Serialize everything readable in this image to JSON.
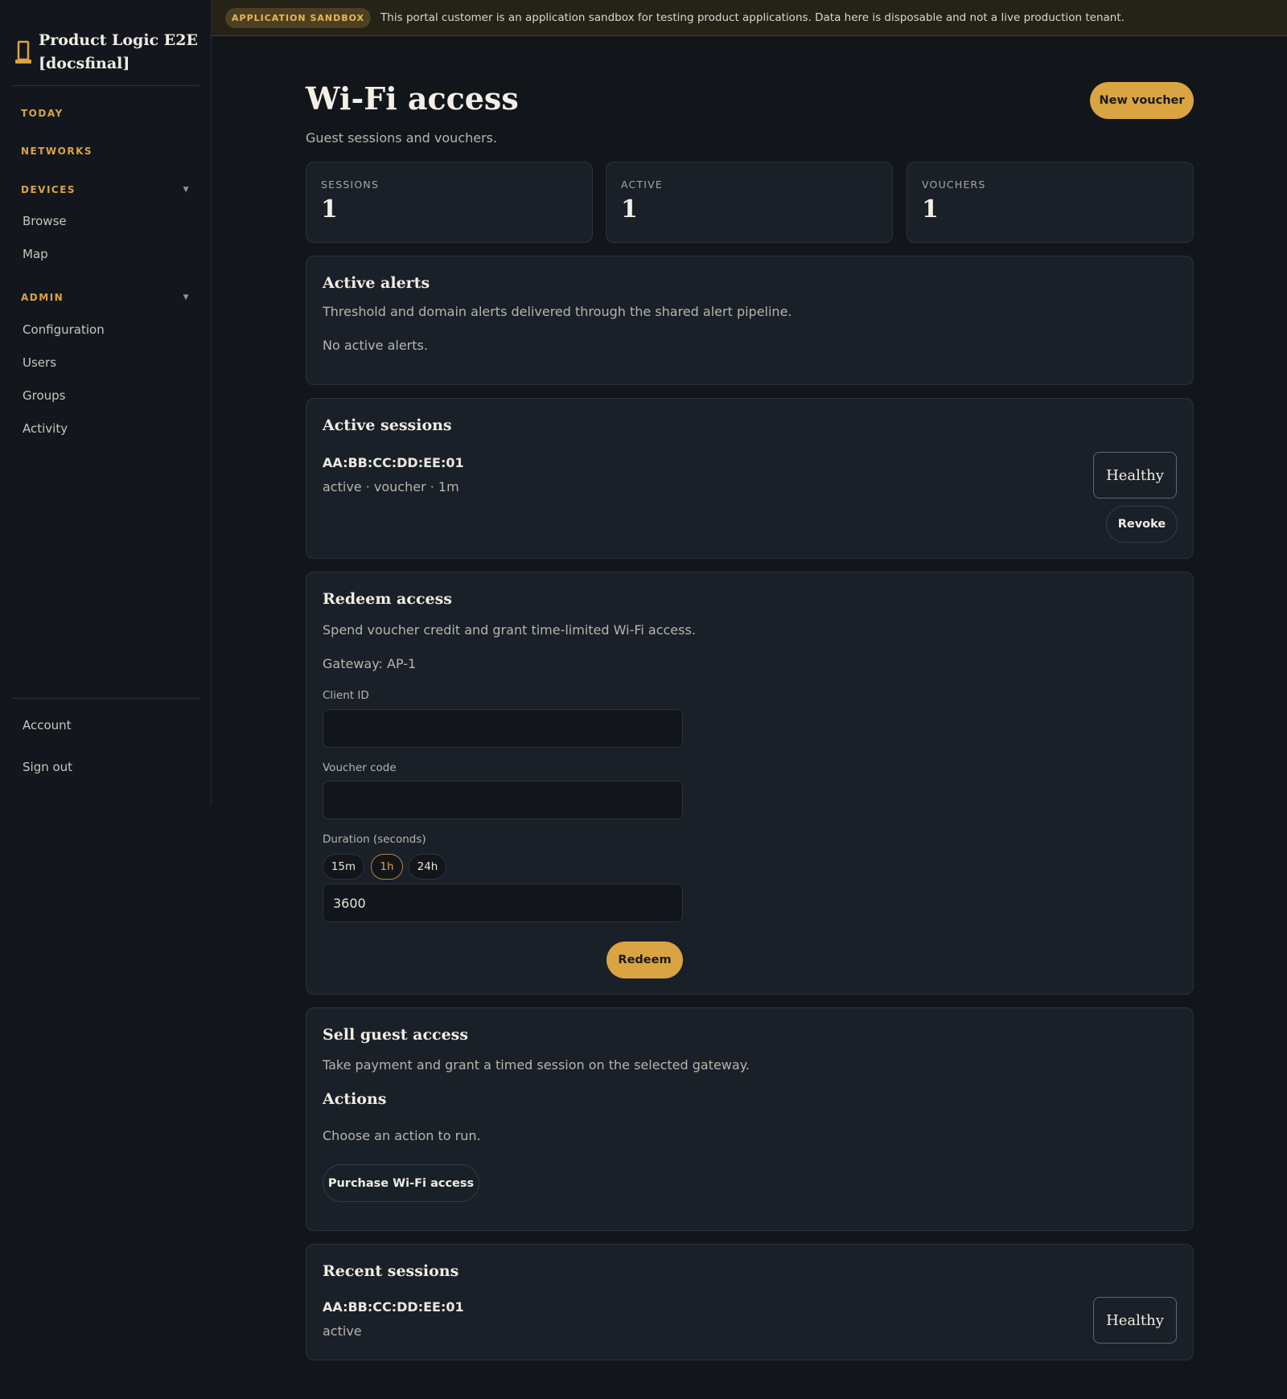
{
  "sidebar": {
    "brand": "Product Logic E2E [docsfinal]",
    "sections": {
      "today": "TODAY",
      "networks": "NETWORKS",
      "devices": "DEVICES",
      "admin": "ADMIN"
    },
    "devices_items": [
      "Browse",
      "Map"
    ],
    "admin_items": [
      "Configuration",
      "Users",
      "Groups",
      "Activity"
    ],
    "footer_items": [
      "Account",
      "Sign out"
    ]
  },
  "banner": {
    "badge": "APPLICATION SANDBOX",
    "text": "This portal customer is an application sandbox for testing product applications. Data here is disposable and not a live production tenant."
  },
  "header": {
    "title": "Wi-Fi access",
    "subtitle": "Guest sessions and vouchers.",
    "new_voucher_label": "New voucher"
  },
  "stats": [
    {
      "label": "SESSIONS",
      "value": "1"
    },
    {
      "label": "ACTIVE",
      "value": "1"
    },
    {
      "label": "VOUCHERS",
      "value": "1"
    }
  ],
  "alerts": {
    "title": "Active alerts",
    "description": "Threshold and domain alerts delivered through the shared alert pipeline.",
    "empty": "No active alerts."
  },
  "active_sessions": {
    "title": "Active sessions",
    "session_id": "AA:BB:CC:DD:EE:01",
    "session_meta": "active · voucher · 1m",
    "status": "Healthy",
    "revoke_label": "Revoke"
  },
  "redeem": {
    "title": "Redeem access",
    "description": "Spend voucher credit and grant time-limited Wi-Fi access.",
    "gateway": "Gateway: AP-1",
    "client_id_label": "Client ID",
    "client_id_value": "",
    "voucher_label": "Voucher code",
    "voucher_value": "",
    "duration_label": "Duration (seconds)",
    "presets": [
      "15m",
      "1h",
      "24h"
    ],
    "selected_preset": "1h",
    "duration_value": "3600",
    "submit_label": "Redeem"
  },
  "sell": {
    "title": "Sell guest access",
    "description": "Take payment and grant a timed session on the selected gateway.",
    "actions_title": "Actions",
    "actions_description": "Choose an action to run.",
    "purchase_label": "Purchase Wi-Fi access"
  },
  "recent_sessions": {
    "title": "Recent sessions",
    "session_id": "AA:BB:CC:DD:EE:01",
    "session_meta": "active",
    "status": "Healthy"
  },
  "colors": {
    "accent": "#d9a441",
    "background": "#12161b",
    "card": "#1a2028"
  }
}
